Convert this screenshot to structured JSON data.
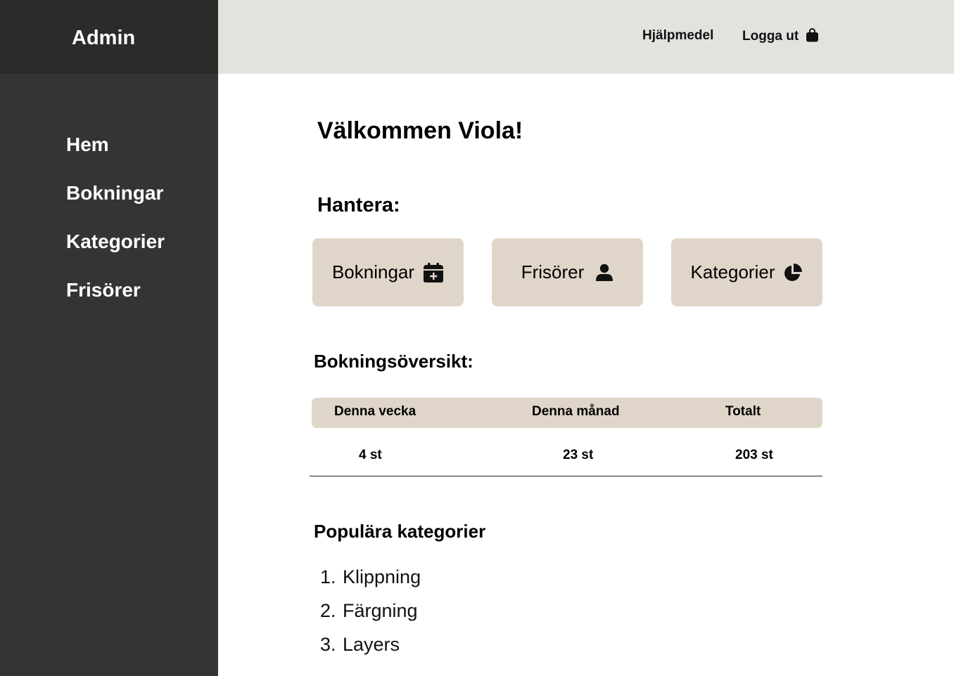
{
  "sidebar": {
    "brand": "Admin",
    "items": [
      {
        "label": "Hem"
      },
      {
        "label": "Bokningar"
      },
      {
        "label": "Kategorier"
      },
      {
        "label": "Frisörer"
      }
    ]
  },
  "header": {
    "help_label": "Hjälpmedel",
    "logout_label": "Logga ut",
    "logout_icon": "bag-icon"
  },
  "main": {
    "welcome": "Välkommen Viola!",
    "manage_title": "Hantera:",
    "manage_buttons": [
      {
        "label": "Bokningar",
        "icon": "calendar-plus-icon"
      },
      {
        "label": "Frisörer",
        "icon": "user-icon"
      },
      {
        "label": "Kategorier",
        "icon": "pie-chart-icon"
      }
    ],
    "overview_title": "Bokningsöversikt:",
    "overview": {
      "headers": [
        "Denna vecka",
        "Denna månad",
        "Totalt"
      ],
      "values": [
        "4 st",
        "23 st",
        "203 st"
      ]
    },
    "popular_title": "Populära kategorier",
    "popular": [
      {
        "num": "1.",
        "label": "Klippning"
      },
      {
        "num": "2.",
        "label": "Färgning"
      },
      {
        "num": "3.",
        "label": "Layers"
      }
    ]
  },
  "colors": {
    "sidebar": "#343432",
    "brand_bar": "#2b2b29",
    "topbar": "#e3e2df",
    "accent_beige": "#dfd6c9"
  }
}
